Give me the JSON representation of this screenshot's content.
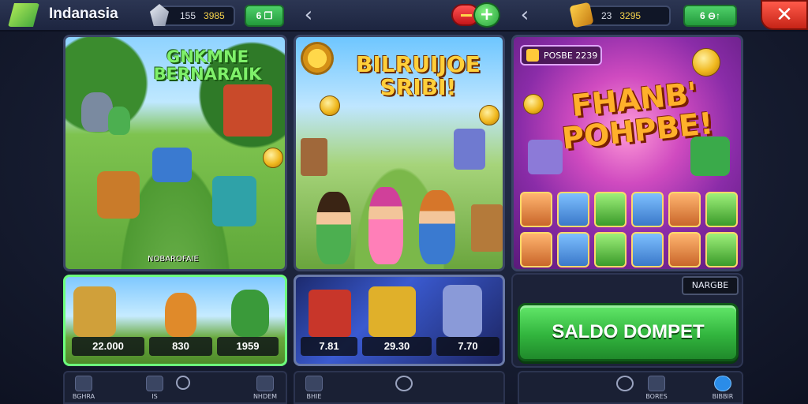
{
  "header": {
    "app_title": "Indanasia",
    "currency_left": {
      "value_a": "155",
      "value_b": "3985"
    },
    "green_btn_left": "6 ❐",
    "currency_right": {
      "value_a": "23",
      "value_b": "3295"
    },
    "green_btn_right": "6 ⊖↑",
    "plus_label": "+",
    "close_label": "✕",
    "back_label": "‹"
  },
  "panels": [
    {
      "title": "GNKMNE BERNARAIK",
      "caption": "NOBAROFAIE"
    },
    {
      "title": "BILRUIJOE SRIBI!"
    },
    {
      "badge": "POSBE 2239",
      "title": "FHANB' POHPBE!"
    }
  ],
  "cards": {
    "card1_prices": [
      "22.000",
      "830",
      "1959"
    ],
    "card2_prices": [
      "7.81",
      "29.30",
      "7.70"
    ]
  },
  "wallet": {
    "small_label": "NARGBE",
    "cta_label": "SALDO DOMPET"
  },
  "nav": {
    "left": [
      "BGHRA",
      "IS",
      "",
      "NHDEM"
    ],
    "middle": [
      "BHIE",
      ""
    ],
    "right": [
      "",
      "BORES",
      "BIBBIR"
    ]
  },
  "colors": {
    "accent_green": "#32b53e",
    "close_red": "#c62417",
    "card_highlight": "#6cff7c"
  }
}
